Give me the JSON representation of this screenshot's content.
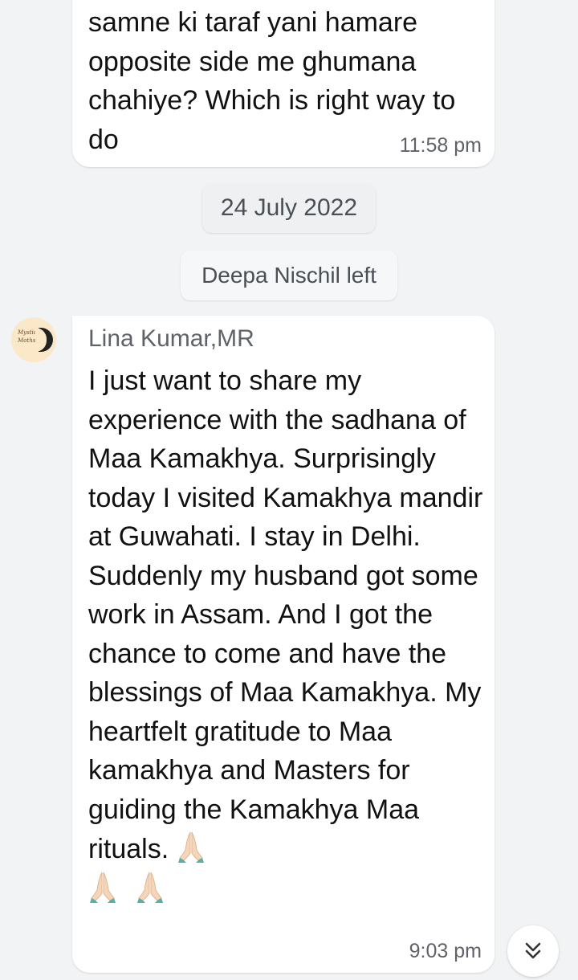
{
  "messages": [
    {
      "text": "samne ki taraf yani hamare opposite side me ghumana chahiye? Which is right way to do",
      "time": "11:58 pm"
    },
    {
      "sender": "Lina Kumar,MR",
      "text": "I just want to share my experience with the sadhana of Maa Kamakhya. Surprisingly today I visited Kamakhya mandir at Guwahati. I stay in Delhi. Suddenly my husband got some work in Assam. And I got the chance to come and have the blessings of Maa Kamakhya. My heartfelt gratitude to Maa kamakhya and Masters for guiding the Kamakhya Maa rituals.",
      "emoji_icons": [
        "folded-hands-icon",
        "folded-hands-icon",
        "folded-hands-icon"
      ],
      "time": "9:03 pm",
      "avatar_text": "Mystic Moths"
    }
  ],
  "date_separator": "24 July 2022",
  "system_message": "Deepa Nischil left",
  "scroll_button_icon": "double-chevron-down-icon",
  "colors": {
    "background": "#f1f3f4",
    "bubble": "#ffffff",
    "text": "#111111",
    "meta_text": "#5f6368"
  }
}
